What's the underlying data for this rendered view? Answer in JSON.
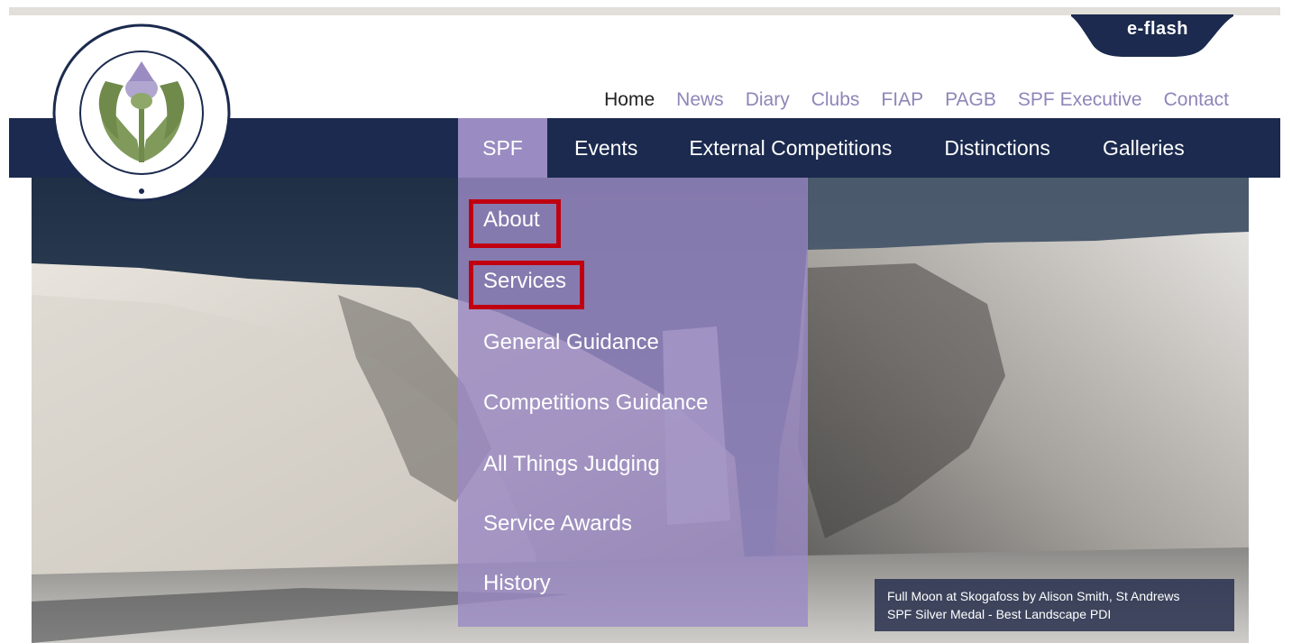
{
  "eflash": {
    "label": "e-flash"
  },
  "logo": {
    "alt": "The Scottish Photographic Federation"
  },
  "utility_nav": [
    {
      "label": "Home",
      "active": true
    },
    {
      "label": "News"
    },
    {
      "label": "Diary"
    },
    {
      "label": "Clubs"
    },
    {
      "label": "FIAP"
    },
    {
      "label": "PAGB"
    },
    {
      "label": "SPF Executive"
    },
    {
      "label": "Contact"
    }
  ],
  "main_nav": {
    "spf": "SPF",
    "events": "Events",
    "external": "External Competitions",
    "distinctions": "Distinctions",
    "galleries": "Galleries"
  },
  "dropdown": [
    {
      "label": "About",
      "highlighted": true
    },
    {
      "label": "Services",
      "highlighted": true
    },
    {
      "label": "General Guidance"
    },
    {
      "label": "Competitions Guidance"
    },
    {
      "label": "All Things Judging"
    },
    {
      "label": "Service Awards"
    },
    {
      "label": "History"
    }
  ],
  "caption": {
    "line1": "Full Moon at Skogafoss by Alison Smith, St Andrews",
    "line2": "SPF Silver Medal - Best Landscape PDI"
  },
  "colors": {
    "nav_bar": "#1b2a4e",
    "accent_purple": "#9a8cc2",
    "highlight_red": "#c00010"
  }
}
